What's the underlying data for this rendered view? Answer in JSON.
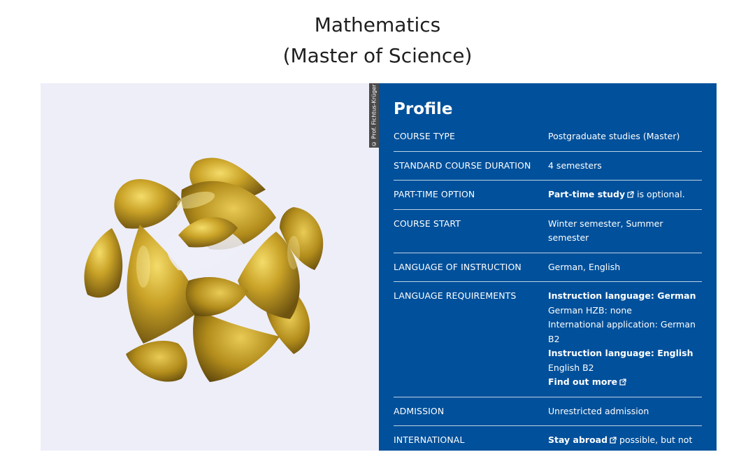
{
  "page": {
    "title_line1": "Mathematics",
    "title_line2": "(Master of Science)"
  },
  "image": {
    "credit": "© Prof. Fichtus-Krüger",
    "background_color": "#eeeef9",
    "object_color": "#c9a227"
  },
  "profile": {
    "heading": "Profile",
    "background_color": "#00509b",
    "rows": {
      "course_type": {
        "label": "COURSE TYPE",
        "value": "Postgraduate studies (Master)"
      },
      "duration": {
        "label": "STANDARD COURSE DURATION",
        "value": "4 semesters"
      },
      "part_time": {
        "label": "PART-TIME OPTION",
        "link": "Part-time study",
        "suffix": " is optional."
      },
      "course_start": {
        "label": "COURSE START",
        "value": "Winter semester, Summer semester"
      },
      "language": {
        "label": "LANGUAGE OF INSTRUCTION",
        "value": "German, English"
      },
      "lang_req": {
        "label": "LANGUAGE REQUIREMENTS",
        "german_heading": "Instruction language: German",
        "german_hzb": "German HZB: none",
        "german_intl": "International application: German B2",
        "english_heading": "Instruction language: English",
        "english_level": "English B2",
        "find_out_more": "Find out more"
      },
      "admission": {
        "label": "ADMISSION",
        "value": "Unrestricted admission"
      },
      "international": {
        "label": "INTERNATIONAL",
        "link": "Stay abroad",
        "suffix": " possible, but not obligatory."
      }
    }
  }
}
